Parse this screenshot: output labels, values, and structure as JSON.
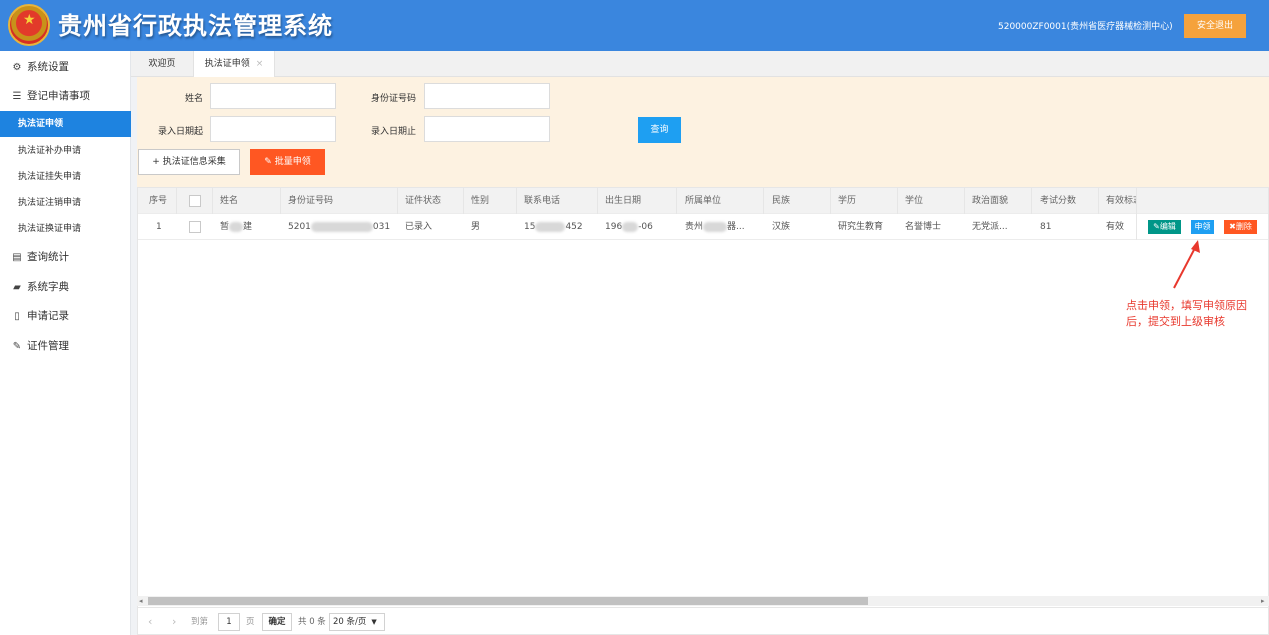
{
  "header": {
    "app_title": "贵州省行政执法管理系统",
    "user_info": "520000ZF0001(贵州省医疗器械检测中心)",
    "logout_label": "安全退出"
  },
  "sidebar": {
    "items": [
      {
        "label": "系统设置",
        "icon": "gear-icon"
      },
      {
        "label": "登记申请事项",
        "icon": "sliders-icon"
      },
      {
        "label": "查询统计",
        "icon": "database-icon"
      },
      {
        "label": "系统字典",
        "icon": "book-icon"
      },
      {
        "label": "申请记录",
        "icon": "document-icon"
      },
      {
        "label": "证件管理",
        "icon": "wrench-icon"
      }
    ],
    "sub_items": [
      {
        "label": "执法证申领",
        "active": true
      },
      {
        "label": "执法证补办申请"
      },
      {
        "label": "执法证挂失申请"
      },
      {
        "label": "执法证注销申请"
      },
      {
        "label": "执法证换证申请"
      }
    ]
  },
  "tabs": [
    {
      "label": "欢迎页"
    },
    {
      "label": "执法证申领",
      "close": "×",
      "active": true
    }
  ],
  "search": {
    "name_label": "姓名",
    "name_value": "",
    "id_label": "身份证号码",
    "id_value": "",
    "date_from_label": "录入日期起",
    "date_from_value": "",
    "date_to_label": "录入日期止",
    "date_to_value": "",
    "query_label": "查询",
    "collect_label": "+ 执法证信息采集",
    "batch_label": "批量申领"
  },
  "table": {
    "columns": [
      "序号",
      "姓名",
      "身份证号码",
      "证件状态",
      "性别",
      "联系电话",
      "出生日期",
      "所属单位",
      "民族",
      "学历",
      "学位",
      "政治面貌",
      "考试分数",
      "有效标志"
    ],
    "rows": [
      {
        "index": "1",
        "name_a": "暂",
        "name_b": "建",
        "id_a": "5201",
        "id_b": "031",
        "status": "已录入",
        "gender": "男",
        "phone_a": "15",
        "phone_b": "452",
        "birth_a": "196",
        "birth_b": "-06",
        "unit_a": "贵州",
        "unit_b": "器...",
        "ethnicity": "汉族",
        "education": "研究生教育",
        "degree": "名誉博士",
        "political": "无党派...",
        "score": "81",
        "valid": "有效",
        "edit_label": "编辑",
        "apply_label": "申领",
        "delete_label": "删除"
      }
    ]
  },
  "pagination": {
    "goto_label": "到第",
    "page_value": "1",
    "page_unit": "页",
    "confirm_label": "确定",
    "total_label": "共 0 条",
    "page_size_label": "20 条/页"
  },
  "annotation": {
    "text": "点击申领，填写申领原因后，提交到上级审核",
    "color": "#e8382d"
  },
  "colors": {
    "header_bg": "#3a86de",
    "active_nav": "#1e83e0",
    "logout_bg": "#f5a23c",
    "query_btn": "#1e9ff2",
    "batch_btn": "#ff5722",
    "edit_btn": "#009688",
    "search_panel_bg": "#fdf2e1"
  }
}
